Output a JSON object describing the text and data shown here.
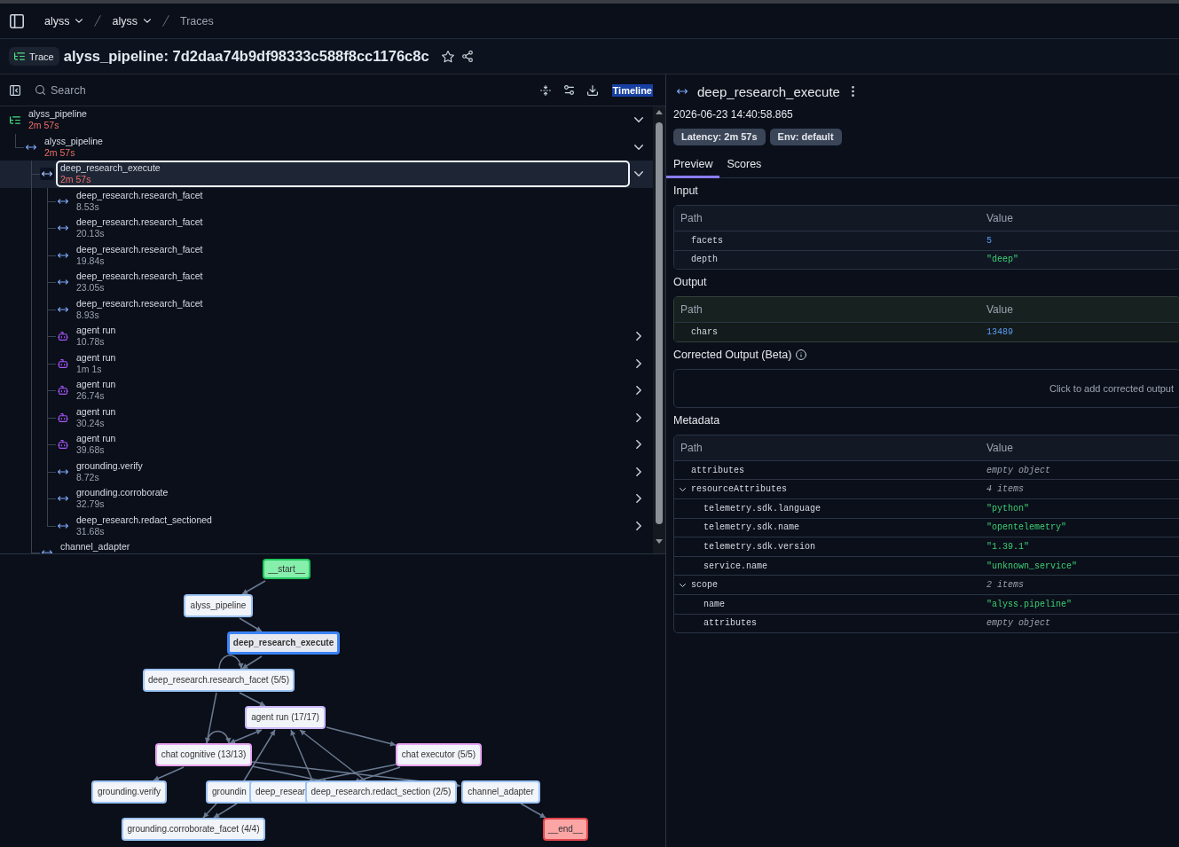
{
  "top_bar": {
    "breadcrumbs": [
      {
        "label": "alyss",
        "dropdown": true,
        "current": false
      },
      {
        "label": "alyss",
        "dropdown": true,
        "current": false
      },
      {
        "label": "Traces",
        "dropdown": false,
        "current": true
      }
    ]
  },
  "header": {
    "badge": "Trace",
    "title": "alyss_pipeline: 7d2daa74b9df98333c588f8cc1176c8c",
    "starred": false
  },
  "trace_panel": {
    "search": {
      "placeholder": "Search"
    },
    "timeline_toggle": {
      "label": "Timeline",
      "selected": true
    },
    "tree": [
      {
        "name": "alyss_pipeline",
        "duration": "2m 57s",
        "kind": "trace",
        "slow": true,
        "selected": false,
        "expanded": true,
        "children": [
          {
            "name": "alyss_pipeline",
            "duration": "2m 57s",
            "kind": "span",
            "slow": true,
            "selected": false,
            "expanded": true,
            "children": [
              {
                "name": "deep_research_execute",
                "duration": "2m 57s",
                "kind": "span",
                "slow": true,
                "selected": true,
                "expanded": true,
                "children": [
                  {
                    "name": "deep_research.research_facet",
                    "duration": "8.53s",
                    "kind": "span",
                    "slow": false,
                    "selected": false
                  },
                  {
                    "name": "deep_research.research_facet",
                    "duration": "20.13s",
                    "kind": "span",
                    "slow": false,
                    "selected": false
                  },
                  {
                    "name": "deep_research.research_facet",
                    "duration": "19.84s",
                    "kind": "span",
                    "slow": false,
                    "selected": false
                  },
                  {
                    "name": "deep_research.research_facet",
                    "duration": "23.05s",
                    "kind": "span",
                    "slow": false,
                    "selected": false
                  },
                  {
                    "name": "deep_research.research_facet",
                    "duration": "8.93s",
                    "kind": "span",
                    "slow": false,
                    "selected": false
                  },
                  {
                    "name": "agent run",
                    "duration": "10.78s",
                    "kind": "agent",
                    "slow": false,
                    "selected": false,
                    "expanded": false
                  },
                  {
                    "name": "agent run",
                    "duration": "1m 1s",
                    "kind": "agent",
                    "slow": false,
                    "selected": false,
                    "expanded": false
                  },
                  {
                    "name": "agent run",
                    "duration": "26.74s",
                    "kind": "agent",
                    "slow": false,
                    "selected": false,
                    "expanded": false
                  },
                  {
                    "name": "agent run",
                    "duration": "30.24s",
                    "kind": "agent",
                    "slow": false,
                    "selected": false,
                    "expanded": false
                  },
                  {
                    "name": "agent run",
                    "duration": "39.68s",
                    "kind": "agent",
                    "slow": false,
                    "selected": false,
                    "expanded": false
                  },
                  {
                    "name": "grounding.verify",
                    "duration": "8.72s",
                    "kind": "span",
                    "slow": false,
                    "selected": false,
                    "expanded": false
                  },
                  {
                    "name": "grounding.corroborate",
                    "duration": "32.79s",
                    "kind": "span",
                    "slow": false,
                    "selected": false,
                    "expanded": false
                  },
                  {
                    "name": "deep_research.redact_sectioned",
                    "duration": "31.68s",
                    "kind": "span",
                    "slow": false,
                    "selected": false,
                    "expanded": false
                  }
                ]
              },
              {
                "name": "channel_adapter",
                "kind": "span",
                "selected": false
              }
            ]
          }
        ]
      }
    ]
  },
  "graph": {
    "nodes": [
      {
        "label": "__start__",
        "kind": "start",
        "selected": false
      },
      {
        "label": "alyss_pipeline",
        "kind": "span",
        "selected": false
      },
      {
        "label": "deep_research_execute",
        "kind": "span",
        "selected": true
      },
      {
        "label": "deep_research.research_facet (5/5)",
        "kind": "span",
        "selected": false
      },
      {
        "label": "agent run (17/17)",
        "kind": "agent",
        "selected": false
      },
      {
        "label": "chat cognitive (13/13)",
        "kind": "generation",
        "selected": false
      },
      {
        "label": "chat executor (5/5)",
        "kind": "generation",
        "selected": false
      },
      {
        "label": "grounding.verify",
        "kind": "span",
        "selected": false
      },
      {
        "label": "groundin",
        "kind": "span",
        "selected": false
      },
      {
        "label": "deep_resear",
        "kind": "span",
        "selected": false
      },
      {
        "label": "deep_research.redact_section (2/5)",
        "kind": "span",
        "selected": false
      },
      {
        "label": "channel_adapter",
        "kind": "span",
        "selected": false
      },
      {
        "label": "grounding.corroborate_facet (4/4)",
        "kind": "span",
        "selected": false
      },
      {
        "label": "__end__",
        "kind": "end",
        "selected": false
      }
    ]
  },
  "detail": {
    "title": "deep_research_execute",
    "timestamp": "2026-06-23 14:40:58.865",
    "badges": [
      "Latency: 2m 57s",
      "Env: default"
    ],
    "tabs": [
      {
        "label": "Preview",
        "selected": true
      },
      {
        "label": "Scores",
        "selected": false
      }
    ],
    "input": {
      "title": "Input",
      "columns": [
        "Path",
        "Value"
      ],
      "rows": [
        {
          "path": "facets",
          "value": "5",
          "kind": "number"
        },
        {
          "path": "depth",
          "value": "\"deep\"",
          "kind": "string"
        }
      ]
    },
    "output": {
      "title": "Output",
      "highlighted": true,
      "columns": [
        "Path",
        "Value"
      ],
      "rows": [
        {
          "path": "chars",
          "value": "13489",
          "kind": "number"
        }
      ]
    },
    "corrected_output": {
      "title": "Corrected Output (Beta)",
      "placeholder": "Click to add corrected output"
    },
    "metadata": {
      "title": "Metadata",
      "columns": [
        "Path",
        "Value"
      ],
      "rows": [
        {
          "path": "attributes",
          "value": "empty object",
          "kind": "note"
        },
        {
          "path": "resourceAttributes",
          "value": "4 items",
          "kind": "note",
          "expanded": true,
          "children": [
            {
              "path": "telemetry.sdk.language",
              "value": "\"python\"",
              "kind": "string"
            },
            {
              "path": "telemetry.sdk.name",
              "value": "\"opentelemetry\"",
              "kind": "string"
            },
            {
              "path": "telemetry.sdk.version",
              "value": "\"1.39.1\"",
              "kind": "string"
            },
            {
              "path": "service.name",
              "value": "\"unknown_service\"",
              "kind": "string"
            }
          ]
        },
        {
          "path": "scope",
          "value": "2 items",
          "kind": "note",
          "expanded": true,
          "children": [
            {
              "path": "name",
              "value": "\"alyss.pipeline\"",
              "kind": "string"
            },
            {
              "path": "attributes",
              "value": "empty object",
              "kind": "note"
            }
          ]
        }
      ]
    }
  }
}
